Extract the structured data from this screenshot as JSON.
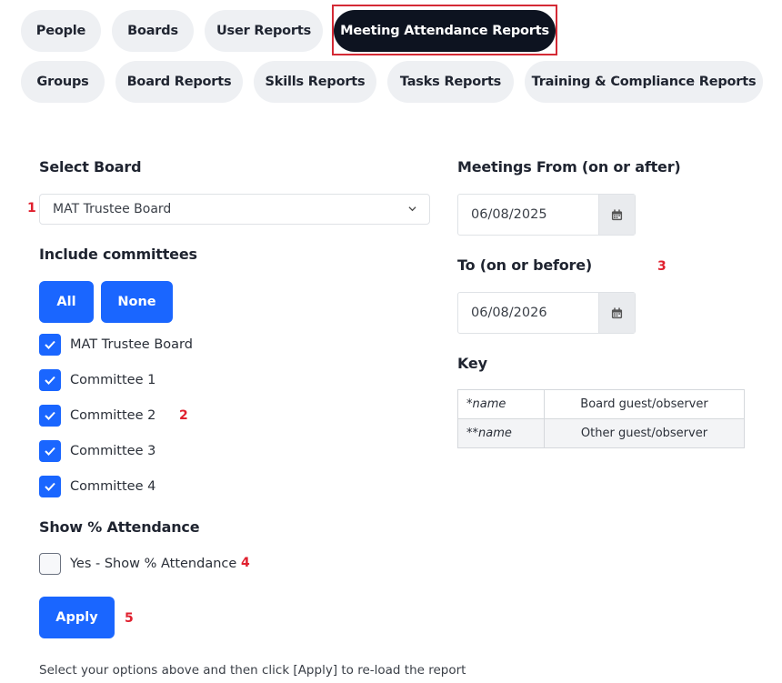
{
  "tabs_row1": [
    {
      "label": "People",
      "active": false
    },
    {
      "label": "Boards",
      "active": false
    },
    {
      "label": "User Reports",
      "active": false
    },
    {
      "label": "Meeting Attendance Reports",
      "active": true
    }
  ],
  "tabs_row2": [
    {
      "label": "Groups"
    },
    {
      "label": "Board Reports"
    },
    {
      "label": "Skills Reports"
    },
    {
      "label": "Tasks Reports"
    },
    {
      "label": "Training & Compliance Reports"
    }
  ],
  "board": {
    "label": "Select Board",
    "selected": "MAT Trustee Board"
  },
  "committees": {
    "label": "Include committees",
    "all_label": "All",
    "none_label": "None",
    "items": [
      {
        "label": "MAT Trustee Board",
        "checked": true
      },
      {
        "label": "Committee 1",
        "checked": true
      },
      {
        "label": "Committee 2",
        "checked": true
      },
      {
        "label": "Committee 3",
        "checked": true
      },
      {
        "label": "Committee 4",
        "checked": true
      }
    ]
  },
  "attendance": {
    "label": "Show % Attendance",
    "option_label": "Yes - Show % Attendance",
    "checked": false
  },
  "apply_label": "Apply",
  "meetings_from": {
    "label": "Meetings From (on or after)",
    "value": "06/08/2025"
  },
  "meetings_to": {
    "label": "To (on or before)",
    "value": "06/08/2026"
  },
  "key": {
    "label": "Key",
    "rows": [
      {
        "symbol": "*name",
        "meaning": "Board guest/observer"
      },
      {
        "symbol": "**name",
        "meaning": "Other guest/observer"
      }
    ]
  },
  "markers": [
    "1",
    "2",
    "3",
    "4",
    "5"
  ],
  "footnote": "Select your options above and then click [Apply] to re-load the report",
  "colors": {
    "accent": "#1a66ff",
    "active_tab": "#0d1320",
    "highlight": "#d42a35",
    "marker": "#e0202e"
  },
  "icons": {
    "select_chevron": "chevron-down-icon",
    "date_picker": "calendar-icon",
    "checkbox": "check-icon"
  }
}
